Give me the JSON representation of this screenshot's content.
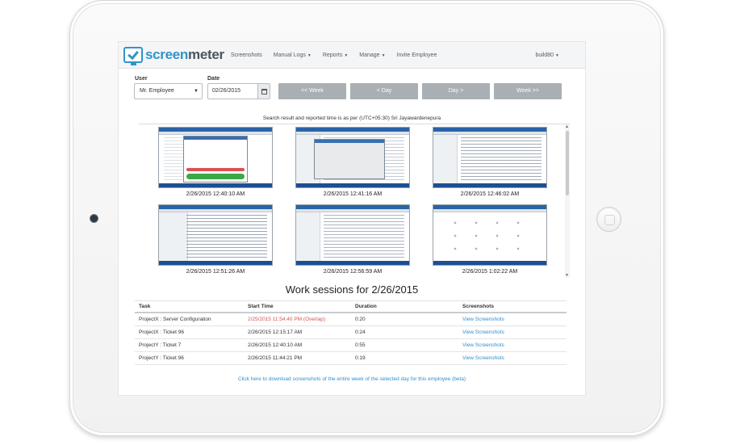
{
  "app": {
    "logo_part1": "screen",
    "logo_part2": "meter"
  },
  "nav": {
    "items": [
      {
        "label": "Screenshots",
        "caret": false
      },
      {
        "label": "Manual Logs",
        "caret": true
      },
      {
        "label": "Reports",
        "caret": true
      },
      {
        "label": "Manage",
        "caret": true
      },
      {
        "label": "Invite Employee",
        "caret": false
      }
    ],
    "user_label": "build80"
  },
  "filters": {
    "user_label": "User",
    "user_value": "Mr. Employee",
    "date_label": "Date",
    "date_value": "02/26/2015"
  },
  "nav_buttons": {
    "prev_week": "<< Week",
    "prev_day": "< Day",
    "next_day": "Day >",
    "next_week": "Week >>"
  },
  "timezone_note": "Search result and reported time is as per (UTC+05:30) Sri Jayawardenepura",
  "screenshots": [
    {
      "timestamp": "2/26/2015 12:40:10 AM"
    },
    {
      "timestamp": "2/26/2015 12:41:16 AM"
    },
    {
      "timestamp": "2/26/2015 12:46:02 AM"
    },
    {
      "timestamp": "2/26/2015 12:51:26 AM"
    },
    {
      "timestamp": "2/26/2015 12:56:59 AM"
    },
    {
      "timestamp": "2/26/2015 1:02:22 AM"
    }
  ],
  "work_sessions": {
    "title": "Work sessions for 2/26/2015",
    "columns": [
      "Task",
      "Start Time",
      "Duration",
      "Screenshots"
    ],
    "rows": [
      {
        "task": "ProjectX : Server Configuration",
        "start": "2/25/2015 11:54:40 PM (Overlap)",
        "duration": "0:20",
        "link": "View Screenshots"
      },
      {
        "task": "ProjectX : Ticket 96",
        "start": "2/26/2015 12:15:17 AM",
        "duration": "0:24",
        "link": "View Screenshots"
      },
      {
        "task": "ProjectY : Ticket 7",
        "start": "2/26/2015 12:40:10 AM",
        "duration": "0:55",
        "link": "View Screenshots"
      },
      {
        "task": "ProjectY : Ticket 96",
        "start": "2/26/2015 11:44:21 PM",
        "duration": "0:19",
        "link": "View Screenshots"
      }
    ]
  },
  "download_link": "Click here to download screenshots of the entire week of the selected day for this employee (beta)",
  "colors": {
    "accent": "#2f95c8",
    "overlap": "#d9534f",
    "button": "#a9afb3"
  }
}
